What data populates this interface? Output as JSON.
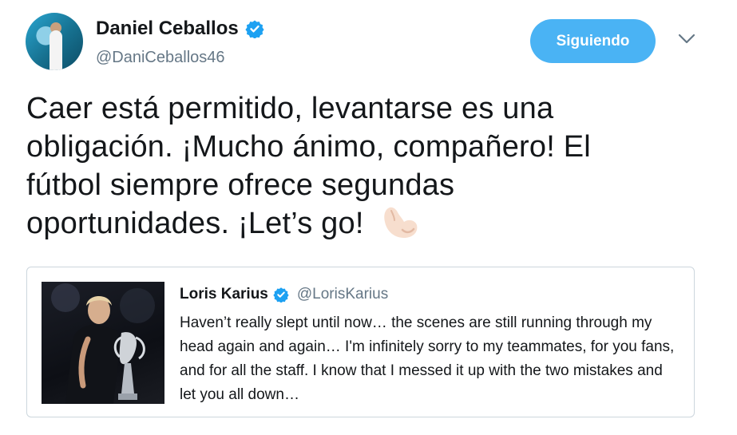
{
  "author": {
    "display_name": "Daniel Ceballos",
    "handle": "@DaniCeballos46",
    "verified": true
  },
  "follow_button": {
    "label": "Siguiendo"
  },
  "tweet": {
    "text": "Caer está permitido, levantarse es una obligación. ¡Mucho ánimo, compañero! El fútbol siempre ofrece segundas oportunidades. ¡Let’s go!",
    "emoji": "flexed-biceps-light-skin-tone"
  },
  "quoted_tweet": {
    "display_name": "Loris Karius",
    "handle": "@LorisKarius",
    "verified": true,
    "text": "Haven’t really slept until now… the scenes are still running through my head again and again… I'm infinitely sorry to my teammates, for you fans, and for all the staff. I know that I messed it up with the two mistakes and let you all down…"
  },
  "colors": {
    "accent": "#4ab3f4",
    "verified": "#1da1f2",
    "secondary_text": "#657786",
    "border": "#ccd6dd"
  }
}
